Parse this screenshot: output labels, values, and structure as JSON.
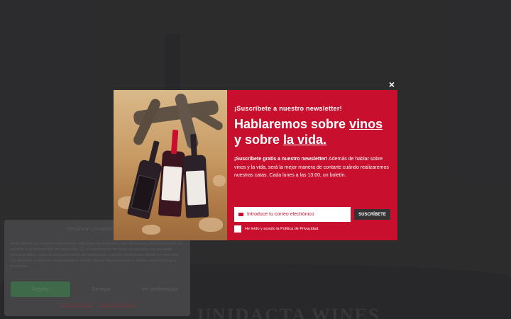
{
  "popup": {
    "kicker": "¡Suscríbete a nuestro newsletter!",
    "headline_part1": "Hablaremos sobre ",
    "headline_link1": "vinos",
    "headline_part2": " y sobre ",
    "headline_link2": "la vida.",
    "desc_bold": "¡Suscríbete gratis a nuestro newsletter!",
    "desc_text": " Además de hablar sobre vinos y la vida, será la mejor manera de contarte cuándo realizaremos nuestras catas. Cada lunes a las 13:00, un boletín.",
    "email_placeholder": "Introduce tu correo electrónico",
    "subscribe_label": "SUSCRÍBETE",
    "consent_label": "He leído y acepto la Política de Privacidad.",
    "close_label": "×"
  },
  "cookie": {
    "title": "Gestionar consentimiento",
    "text": "Para ofrecer las mejores experiencias, utilizamos tecnologías como las cookies para almacenar y/o acceder a la información del dispositivo. El consentimiento de estas tecnologías nos permitirá procesar datos como el comportamiento de navegación o las identificaciones únicas en este sitio. No consentir o retirar el consentimiento, puede afectar negativamente a ciertas características y funciones.",
    "accept_label": "Aceptar",
    "deny_label": "Denegar",
    "prefs_label": "Ver preferencias",
    "link_cookies": "Política de Cookies",
    "link_privacy": "Política de Privacidad"
  },
  "background": {
    "brand": "UNIDACTA WINES"
  },
  "colors": {
    "accent": "#c8102e",
    "button_dark": "#333333"
  }
}
